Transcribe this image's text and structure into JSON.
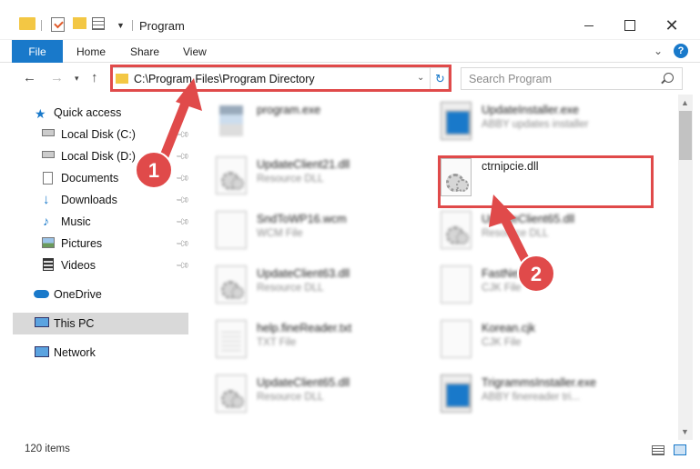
{
  "window": {
    "title": "Program"
  },
  "ribbon": {
    "tabs": [
      "File",
      "Home",
      "Share",
      "View"
    ]
  },
  "address": {
    "path": "C:\\Program Files\\Program Directory"
  },
  "search": {
    "placeholder": "Search Program"
  },
  "sidebar": {
    "items": [
      {
        "label": "Quick access",
        "icon": "star-icon",
        "pinned": false
      },
      {
        "label": "Local Disk (C:)",
        "icon": "drive-icon",
        "pinned": true
      },
      {
        "label": "Local Disk (D:)",
        "icon": "drive-icon",
        "pinned": true
      },
      {
        "label": "Documents",
        "icon": "documents-icon",
        "pinned": true
      },
      {
        "label": "Downloads",
        "icon": "download-icon",
        "pinned": true
      },
      {
        "label": "Music",
        "icon": "music-icon",
        "pinned": true
      },
      {
        "label": "Pictures",
        "icon": "pictures-icon",
        "pinned": true
      },
      {
        "label": "Videos",
        "icon": "videos-icon",
        "pinned": true
      },
      {
        "label": "OneDrive",
        "icon": "cloud-icon",
        "pinned": false
      },
      {
        "label": "This PC",
        "icon": "computer-icon",
        "pinned": false,
        "selected": true
      },
      {
        "label": "Network",
        "icon": "network-icon",
        "pinned": false
      }
    ]
  },
  "files": [
    {
      "name": "program.exe",
      "type": "",
      "icon": "program-icon"
    },
    {
      "name": "UpdateInstaller.exe",
      "type": "ABBY updates installer",
      "icon": "exe-icon"
    },
    {
      "name": "UpdateClient21.dll",
      "type": "Resource DLL",
      "icon": "dll-icon"
    },
    {
      "name": "ctrnipcie.dll",
      "type": "",
      "icon": "dll-icon"
    },
    {
      "name": "SndToWP16.wcm",
      "type": "WCM File",
      "icon": "file-icon"
    },
    {
      "name": "UpdateClient65.dll",
      "type": "Resource DLL",
      "icon": "dll-icon"
    },
    {
      "name": "UpdateClient63.dll",
      "type": "Resource DLL",
      "icon": "dll-icon"
    },
    {
      "name": "FastNet.cjk",
      "type": "CJK File",
      "icon": "file-icon"
    },
    {
      "name": "help.fineReader.txt",
      "type": "TXT File",
      "icon": "text-icon"
    },
    {
      "name": "Korean.cjk",
      "type": "CJK File",
      "icon": "file-icon"
    },
    {
      "name": "UpdateClient65.dll",
      "type": "Resource DLL",
      "icon": "dll-icon"
    },
    {
      "name": "TrigrammsInstaller.exe",
      "type": "ABBY finereader tri...",
      "icon": "exe-icon"
    }
  ],
  "annotations": [
    {
      "number": "1",
      "target": "address-bar"
    },
    {
      "number": "2",
      "target": "ctrnipcie.dll"
    }
  ],
  "status": {
    "item_count": "120 items"
  },
  "colors": {
    "accent": "#1979ca",
    "highlight": "#e04a4a"
  }
}
